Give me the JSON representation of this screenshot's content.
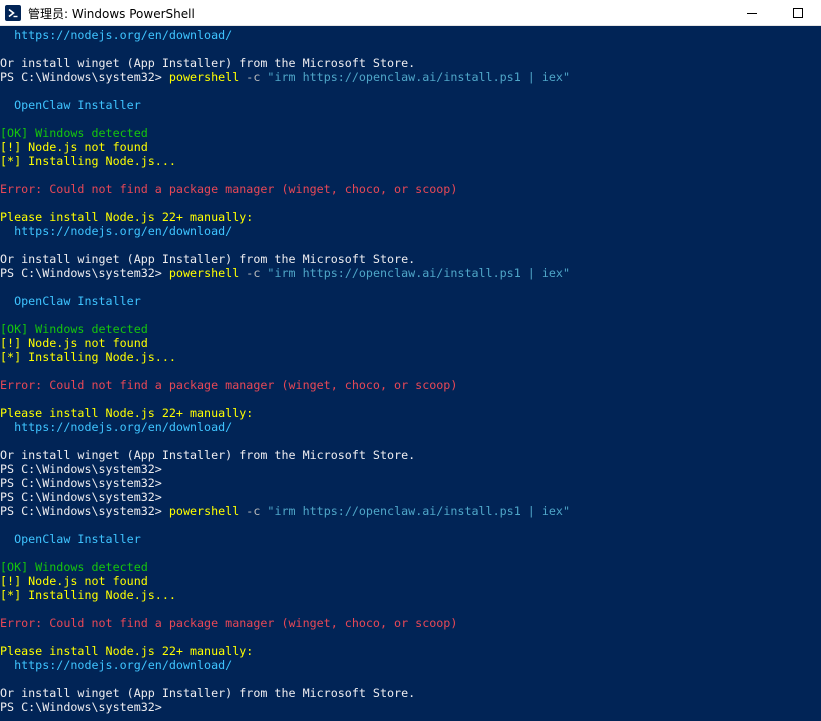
{
  "window": {
    "title": "管理员: Windows PowerShell",
    "icon": "powershell-icon",
    "controls": [
      "minimize-icon",
      "maximize-icon"
    ]
  },
  "colors": {
    "background": "#012456",
    "default": "#eeedf0",
    "yellow": "#ffff00",
    "cyan": "#3fc4ff",
    "green": "#16c60c",
    "red": "#e74856",
    "string": "#4fa6c8"
  },
  "console": {
    "lines": [
      [
        {
          "t": "  https://nodejs.org/en/download/",
          "c": "cyan"
        }
      ],
      [
        {
          "t": "",
          "c": "default"
        }
      ],
      [
        {
          "t": "Or install winget (App Installer) from the Microsoft Store.",
          "c": "default"
        }
      ],
      [
        {
          "t": "PS C:\\Windows\\system32> ",
          "c": "default"
        },
        {
          "t": "powershell",
          "c": "cmd"
        },
        {
          "t": " -c ",
          "c": "arg"
        },
        {
          "t": "\"irm https://openclaw.ai/install.ps1 | iex\"",
          "c": "str"
        }
      ],
      [
        {
          "t": "",
          "c": "default"
        }
      ],
      [
        {
          "t": "  OpenClaw Installer",
          "c": "cyan"
        }
      ],
      [
        {
          "t": "",
          "c": "default"
        }
      ],
      [
        {
          "t": "[OK] Windows detected",
          "c": "green"
        }
      ],
      [
        {
          "t": "[!] Node.js not found",
          "c": "yellow"
        }
      ],
      [
        {
          "t": "[*] Installing Node.js...",
          "c": "yellow"
        }
      ],
      [
        {
          "t": "",
          "c": "default"
        }
      ],
      [
        {
          "t": "Error: Could not find a package manager (winget, choco, or scoop)",
          "c": "red"
        }
      ],
      [
        {
          "t": "",
          "c": "default"
        }
      ],
      [
        {
          "t": "Please install Node.js 22+ manually:",
          "c": "yellow"
        }
      ],
      [
        {
          "t": "  https://nodejs.org/en/download/",
          "c": "cyan"
        }
      ],
      [
        {
          "t": "",
          "c": "default"
        }
      ],
      [
        {
          "t": "Or install winget (App Installer) from the Microsoft Store.",
          "c": "default"
        }
      ],
      [
        {
          "t": "PS C:\\Windows\\system32> ",
          "c": "default"
        },
        {
          "t": "powershell",
          "c": "cmd"
        },
        {
          "t": " -c ",
          "c": "arg"
        },
        {
          "t": "\"irm https://openclaw.ai/install.ps1 | iex\"",
          "c": "str"
        }
      ],
      [
        {
          "t": "",
          "c": "default"
        }
      ],
      [
        {
          "t": "  OpenClaw Installer",
          "c": "cyan"
        }
      ],
      [
        {
          "t": "",
          "c": "default"
        }
      ],
      [
        {
          "t": "[OK] Windows detected",
          "c": "green"
        }
      ],
      [
        {
          "t": "[!] Node.js not found",
          "c": "yellow"
        }
      ],
      [
        {
          "t": "[*] Installing Node.js...",
          "c": "yellow"
        }
      ],
      [
        {
          "t": "",
          "c": "default"
        }
      ],
      [
        {
          "t": "Error: Could not find a package manager (winget, choco, or scoop)",
          "c": "red"
        }
      ],
      [
        {
          "t": "",
          "c": "default"
        }
      ],
      [
        {
          "t": "Please install Node.js 22+ manually:",
          "c": "yellow"
        }
      ],
      [
        {
          "t": "  https://nodejs.org/en/download/",
          "c": "cyan"
        }
      ],
      [
        {
          "t": "",
          "c": "default"
        }
      ],
      [
        {
          "t": "Or install winget (App Installer) from the Microsoft Store.",
          "c": "default"
        }
      ],
      [
        {
          "t": "PS C:\\Windows\\system32>",
          "c": "default"
        }
      ],
      [
        {
          "t": "PS C:\\Windows\\system32>",
          "c": "default"
        }
      ],
      [
        {
          "t": "PS C:\\Windows\\system32>",
          "c": "default"
        }
      ],
      [
        {
          "t": "PS C:\\Windows\\system32> ",
          "c": "default"
        },
        {
          "t": "powershell",
          "c": "cmd"
        },
        {
          "t": " -c ",
          "c": "arg"
        },
        {
          "t": "\"irm https://openclaw.ai/install.ps1 | iex\"",
          "c": "str"
        }
      ],
      [
        {
          "t": "",
          "c": "default"
        }
      ],
      [
        {
          "t": "  OpenClaw Installer",
          "c": "cyan"
        }
      ],
      [
        {
          "t": "",
          "c": "default"
        }
      ],
      [
        {
          "t": "[OK] Windows detected",
          "c": "green"
        }
      ],
      [
        {
          "t": "[!] Node.js not found",
          "c": "yellow"
        }
      ],
      [
        {
          "t": "[*] Installing Node.js...",
          "c": "yellow"
        }
      ],
      [
        {
          "t": "",
          "c": "default"
        }
      ],
      [
        {
          "t": "Error: Could not find a package manager (winget, choco, or scoop)",
          "c": "red"
        }
      ],
      [
        {
          "t": "",
          "c": "default"
        }
      ],
      [
        {
          "t": "Please install Node.js 22+ manually:",
          "c": "yellow"
        }
      ],
      [
        {
          "t": "  https://nodejs.org/en/download/",
          "c": "cyan"
        }
      ],
      [
        {
          "t": "",
          "c": "default"
        }
      ],
      [
        {
          "t": "Or install winget (App Installer) from the Microsoft Store.",
          "c": "default"
        }
      ],
      [
        {
          "t": "PS C:\\Windows\\system32>",
          "c": "default"
        }
      ]
    ]
  }
}
